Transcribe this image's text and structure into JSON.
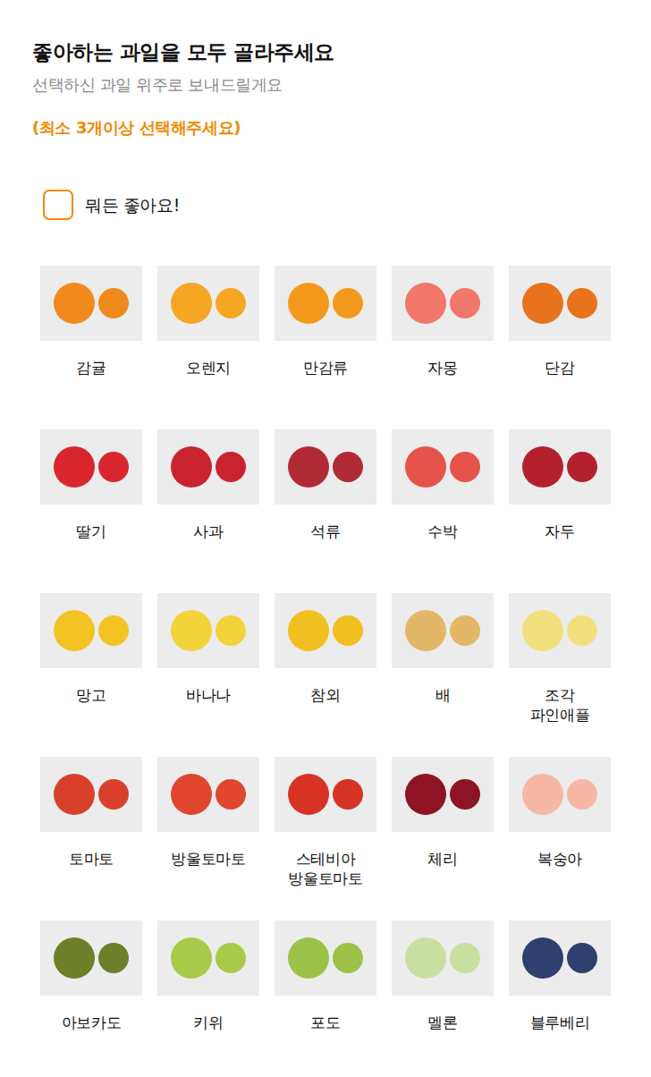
{
  "header": {
    "title": "좋아하는 과일을 모두 골라주세요",
    "subtitle": "선택하신 과일 위주로 보내드릴게요",
    "notice": "(최소 3개이상 선택해주세요)"
  },
  "any_option": {
    "label": "뭐든 좋아요!",
    "checked": false
  },
  "fruits": [
    {
      "label": "감귤",
      "selected": false,
      "color": "#f08a1c"
    },
    {
      "label": "오렌지",
      "selected": false,
      "color": "#f5a623"
    },
    {
      "label": "만감류",
      "selected": false,
      "color": "#f39a1e"
    },
    {
      "label": "자몽",
      "selected": false,
      "color": "#f0776a"
    },
    {
      "label": "단감",
      "selected": false,
      "color": "#e8731c"
    },
    {
      "label": "딸기",
      "selected": false,
      "color": "#d9262c"
    },
    {
      "label": "사과",
      "selected": false,
      "color": "#c8232e"
    },
    {
      "label": "석류",
      "selected": false,
      "color": "#b02a35"
    },
    {
      "label": "수박",
      "selected": false,
      "color": "#e5534b"
    },
    {
      "label": "자두",
      "selected": false,
      "color": "#b5202f"
    },
    {
      "label": "망고",
      "selected": false,
      "color": "#f3c323"
    },
    {
      "label": "바나나",
      "selected": false,
      "color": "#f2d33a"
    },
    {
      "label": "참외",
      "selected": false,
      "color": "#f0c020"
    },
    {
      "label": "배",
      "selected": false,
      "color": "#e2b868"
    },
    {
      "label": "조각\n파인애플",
      "selected": false,
      "color": "#f2df7e"
    },
    {
      "label": "토마토",
      "selected": false,
      "color": "#d8402c"
    },
    {
      "label": "방울토마토",
      "selected": false,
      "color": "#e0452e"
    },
    {
      "label": "스테비아\n방울토마토",
      "selected": false,
      "color": "#d63325"
    },
    {
      "label": "체리",
      "selected": false,
      "color": "#8e1424"
    },
    {
      "label": "복숭아",
      "selected": false,
      "color": "#f6b7a5"
    },
    {
      "label": "아보카도",
      "selected": false,
      "color": "#6e7f2a"
    },
    {
      "label": "키위",
      "selected": false,
      "color": "#a9c94a"
    },
    {
      "label": "포도",
      "selected": false,
      "color": "#9cc24a"
    },
    {
      "label": "멜론",
      "selected": false,
      "color": "#c9dfa0"
    },
    {
      "label": "블루베리",
      "selected": false,
      "color": "#2f3f6e"
    }
  ]
}
